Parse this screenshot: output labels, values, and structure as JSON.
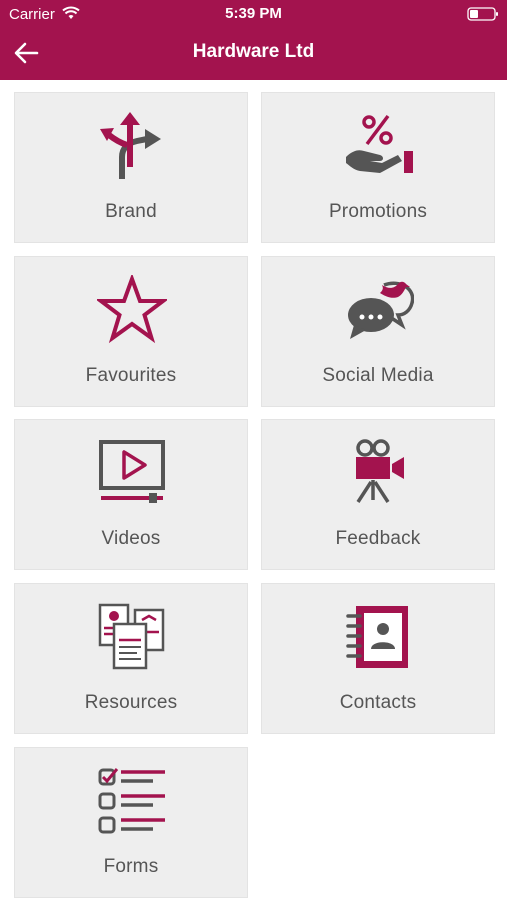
{
  "status_bar": {
    "carrier": "Carrier",
    "time": "5:39 PM"
  },
  "nav": {
    "title": "Hardware Ltd",
    "back_icon": "arrow-left-icon"
  },
  "colors": {
    "brand": "#a3134e",
    "icon_gray": "#555555",
    "tile_bg": "#eeeeee"
  },
  "tiles": [
    {
      "label": "Brand",
      "icon": "direction-arrows-icon"
    },
    {
      "label": "Promotions",
      "icon": "percent-hand-icon"
    },
    {
      "label": "Favourites",
      "icon": "star-icon"
    },
    {
      "label": "Social Media",
      "icon": "chat-bird-icon"
    },
    {
      "label": "Videos",
      "icon": "video-player-icon"
    },
    {
      "label": "Feedback",
      "icon": "camera-icon"
    },
    {
      "label": "Resources",
      "icon": "documents-icon"
    },
    {
      "label": "Contacts",
      "icon": "address-book-icon"
    },
    {
      "label": "Forms",
      "icon": "checklist-icon"
    }
  ]
}
